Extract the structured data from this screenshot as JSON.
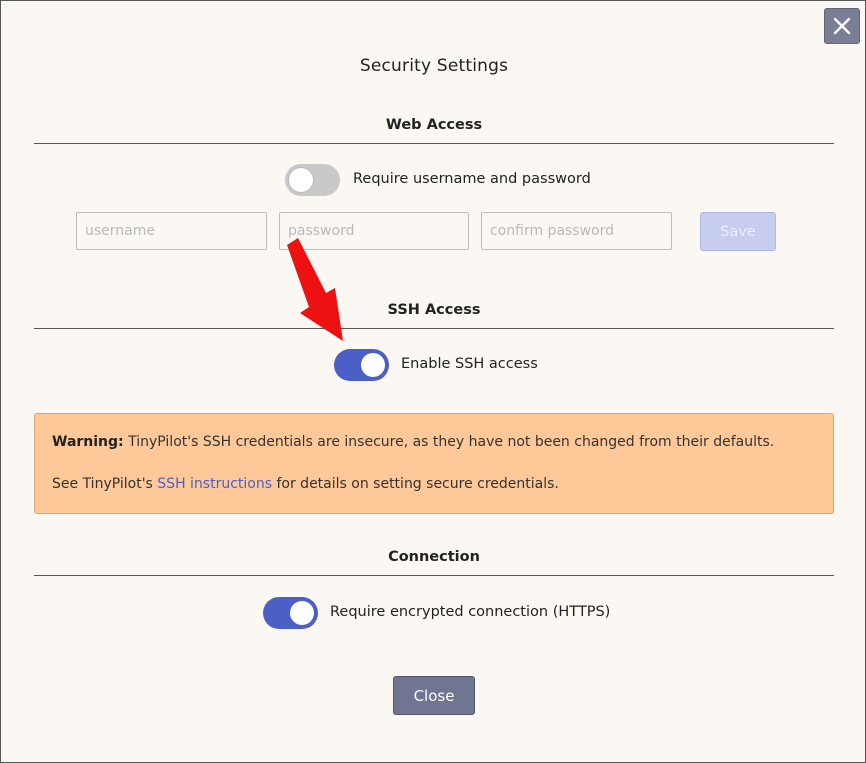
{
  "dialog": {
    "title": "Security Settings",
    "close_button_label": "Close"
  },
  "web_access": {
    "heading": "Web Access",
    "toggle_label": "Require username and password",
    "toggle_state": "off",
    "username_placeholder": "username",
    "password_placeholder": "password",
    "confirm_password_placeholder": "confirm password",
    "save_label": "Save"
  },
  "ssh_access": {
    "heading": "SSH Access",
    "toggle_label": "Enable SSH access",
    "toggle_state": "on"
  },
  "warning": {
    "bold_prefix": "Warning:",
    "message": " TinyPilot's SSH credentials are insecure, as they have not been changed from their defaults.",
    "see_prefix": "See TinyPilot's ",
    "link_text": "SSH instructions",
    "see_suffix": " for details on setting secure credentials."
  },
  "connection": {
    "heading": "Connection",
    "toggle_label": "Require encrypted connection (HTTPS)",
    "toggle_state": "on"
  },
  "colors": {
    "accent": "#4c5fc6",
    "warning_bg": "#fec898",
    "annotation_arrow": "#ee1111"
  },
  "icons": {
    "dialog_close": "close-icon",
    "annotation": "red-arrow-icon"
  }
}
